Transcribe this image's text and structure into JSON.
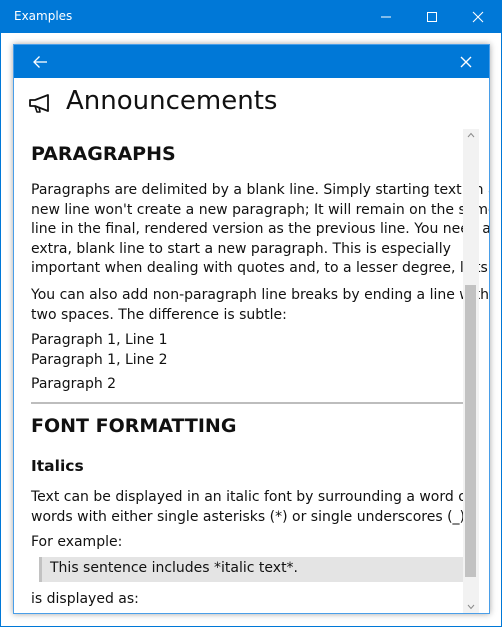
{
  "window": {
    "title": "Examples",
    "accent_color": "#0078d7",
    "controls": [
      "minimize-icon",
      "maximize-icon",
      "close-icon"
    ]
  },
  "dialog": {
    "back_icon": "back-arrow-icon",
    "close_icon": "close-icon",
    "header_icon": "megaphone-icon",
    "title": "Announcements"
  },
  "content": {
    "section1_title": "PARAGRAPHS",
    "p1": [
      "Paragraphs are delimited by a blank line. Simply starting text on a",
      "new line won't create a new paragraph; It will remain on the same",
      "line in the final, rendered version as the previous line. You need an",
      "extra, blank line to start a new paragraph. This is especially",
      "important when dealing with quotes and, to a lesser degree, lists."
    ],
    "p2": [
      "You can also add non-paragraph line breaks by ending a line with",
      "two spaces. The difference is subtle:"
    ],
    "p3": [
      "Paragraph 1, Line 1",
      "Paragraph 1, Line 2"
    ],
    "p4": "Paragraph 2",
    "section2_title": "FONT FORMATTING",
    "subsection_title": "Italics",
    "p5": [
      "Text can be displayed in an italic font by surrounding a word or",
      "words with either single asterisks (*) or single underscores (_)."
    ],
    "p6": "For example:",
    "quote": "This sentence includes *italic text*.",
    "p7": "is displayed as:"
  }
}
